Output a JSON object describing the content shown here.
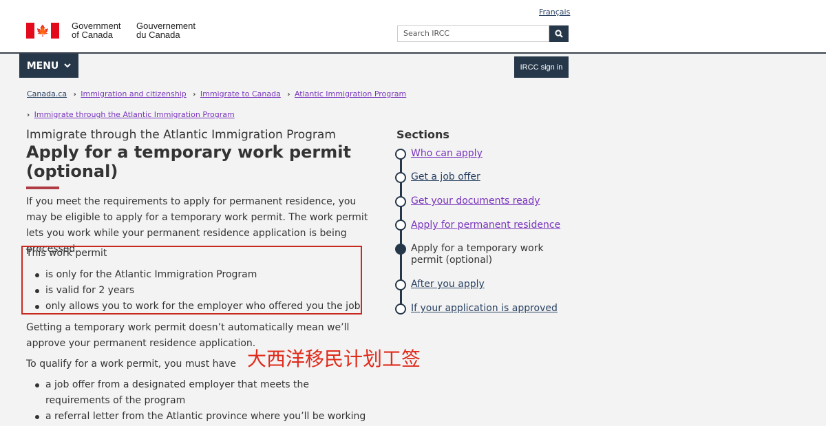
{
  "header": {
    "language_link": "Français",
    "gov_en_line1": "Government",
    "gov_en_line2": "of Canada",
    "gov_fr_line1": "Gouvernement",
    "gov_fr_line2": "du Canada",
    "search_placeholder": "Search IRCC",
    "menu_label": "MENU",
    "signin_label": "IRCC sign in"
  },
  "breadcrumb": [
    "Canada.ca",
    "Immigration and citizenship",
    "Immigrate to Canada",
    "Atlantic Immigration Program",
    "Immigrate through the Atlantic Immigration Program"
  ],
  "main": {
    "subtitle": "Immigrate through the Atlantic Immigration Program",
    "title": "Apply for a temporary work permit (optional)",
    "intro": "If you meet the requirements to apply for permanent residence, you may be eligible to apply for a temporary work permit. The work permit lets you work while your permanent residence application is being processed.",
    "work_permit_label": "This work permit",
    "work_permit_items": [
      "is only for the Atlantic Immigration Program",
      "is valid for 2 years",
      "only allows you to work for the employer who offered you the job"
    ],
    "note": "Getting a temporary work permit doesn’t automatically mean we’ll approve your permanent residence application.",
    "qualify_label": "To qualify for a work permit, you must have",
    "qualify_items": [
      "a job offer from a designated employer that meets the requirements of the program",
      "a referral letter from the Atlantic province where you’ll be working"
    ],
    "annotation": "大西洋移民计划工签"
  },
  "sections": {
    "heading": "Sections",
    "items": [
      "Who can apply",
      "Get a job offer",
      "Get your documents ready",
      "Apply for permanent residence",
      "Apply for a temporary work permit (optional)",
      "After you apply",
      "If your application is approved"
    ],
    "current_index": 4
  },
  "colors": {
    "navy": "#26374a",
    "link_visited": "#7834bc",
    "link": "#284162",
    "accent_red": "#af3c43",
    "annotation_red": "#e02a1a",
    "flag_red": "#e30a1b"
  }
}
